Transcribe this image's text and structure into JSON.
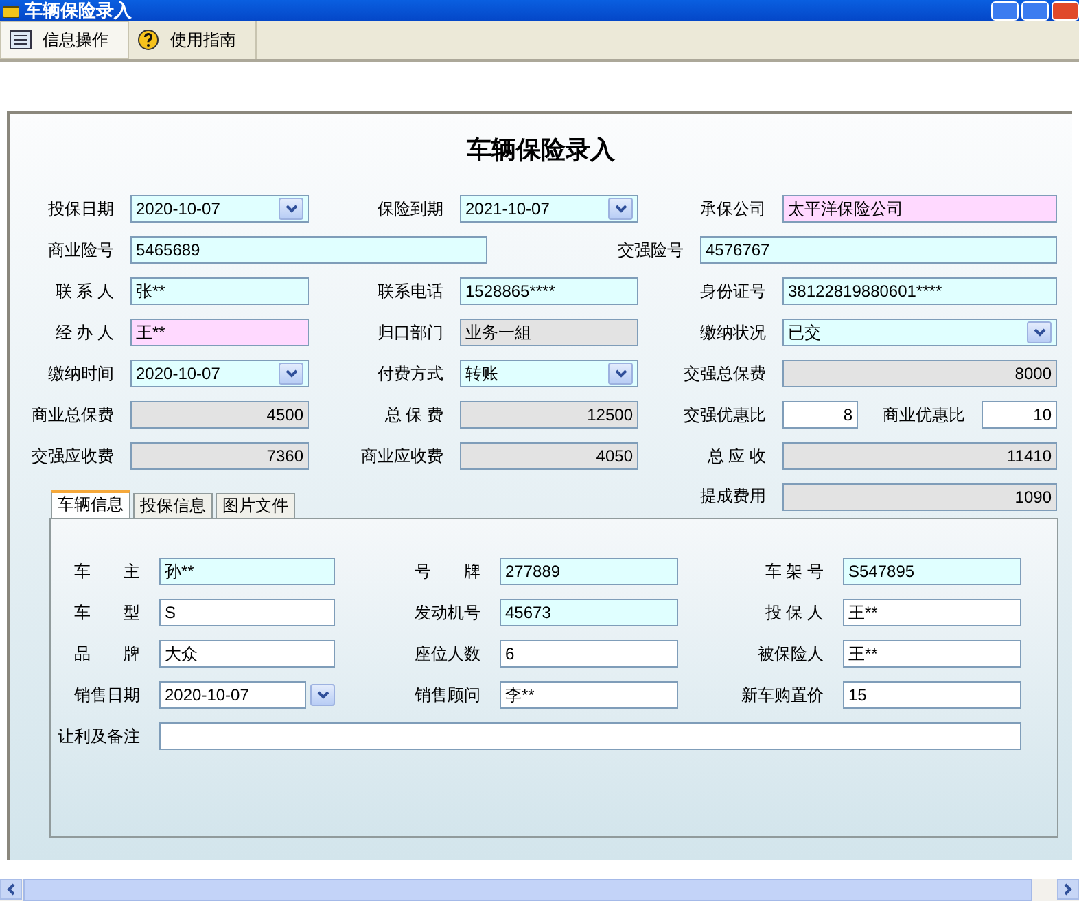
{
  "window": {
    "title": "车辆保险录入"
  },
  "toolbar": [
    {
      "label": "信息操作",
      "selected": true
    },
    {
      "label": "使用指南",
      "selected": false
    }
  ],
  "form": {
    "title": "车辆保险录入",
    "rows": [
      [
        {
          "label": "投保日期",
          "value": "2020-10-07",
          "kind": "date",
          "color": "#e0ffff"
        },
        {
          "label": "保险到期",
          "value": "2021-10-07",
          "kind": "date",
          "color": "#e0ffff"
        },
        {
          "label": "承保公司",
          "value": "太平洋保险公司",
          "kind": "text",
          "color": "#ffd9ff"
        }
      ],
      [
        {
          "label": "商业险号",
          "value": "5465689",
          "kind": "text",
          "color": "#e0ffff"
        },
        {
          "label": "交强险号",
          "value": "4576767",
          "kind": "text",
          "color": "#e0ffff"
        }
      ],
      [
        {
          "label": "联 系 人",
          "value": "张**",
          "kind": "text",
          "color": "#e0ffff"
        },
        {
          "label": "联系电话",
          "value": "1528865****",
          "kind": "text",
          "color": "#e0ffff"
        },
        {
          "label": "身份证号",
          "value": "38122819880601****",
          "kind": "text",
          "color": "#e0ffff"
        }
      ],
      [
        {
          "label": "经 办 人",
          "value": "王**",
          "kind": "text",
          "color": "#ffd9ff"
        },
        {
          "label": "归口部门",
          "value": "业务一組",
          "kind": "text",
          "color": "#e3e3e3"
        },
        {
          "label": "缴纳状况",
          "value": "已交",
          "kind": "select",
          "color": "#e0ffff"
        }
      ],
      [
        {
          "label": "缴纳时间",
          "value": "2020-10-07",
          "kind": "date",
          "color": "#e0ffff"
        },
        {
          "label": "付费方式",
          "value": "转账",
          "kind": "select",
          "color": "#e0ffff"
        },
        {
          "label": "交强总保费",
          "value": "8000",
          "kind": "number",
          "color": "#e3e3e3"
        }
      ],
      [
        {
          "label": "商业总保费",
          "value": "4500",
          "kind": "number",
          "color": "#e3e3e3"
        },
        {
          "label": "总 保 费",
          "value": "12500",
          "kind": "number",
          "color": "#e3e3e3"
        },
        {
          "label": "交强优惠比",
          "value": "8",
          "kind": "number",
          "color": "#ffffff"
        },
        {
          "label": "商业优惠比",
          "value": "10",
          "kind": "number",
          "color": "#ffffff"
        }
      ],
      [
        {
          "label": "交强应收费",
          "value": "7360",
          "kind": "number",
          "color": "#e3e3e3"
        },
        {
          "label": "商业应收费",
          "value": "4050",
          "kind": "number",
          "color": "#e3e3e3"
        },
        {
          "label": "总 应 收",
          "value": "11410",
          "kind": "number",
          "color": "#e3e3e3"
        }
      ]
    ],
    "commission": {
      "label": "提成费用",
      "value": "1090",
      "kind": "number",
      "color": "#e3e3e3"
    }
  },
  "tabs": [
    {
      "label": "车辆信息",
      "selected": true
    },
    {
      "label": "投保信息",
      "selected": false
    },
    {
      "label": "图片文件",
      "selected": false
    }
  ],
  "vehicle_rows": [
    [
      {
        "label": "车　　主",
        "value": "孙**",
        "kind": "text",
        "color": "#e0ffff"
      },
      {
        "label": "号　　牌",
        "value": "277889",
        "kind": "text",
        "color": "#e0ffff"
      },
      {
        "label": "车 架 号",
        "value": "S547895",
        "kind": "text",
        "color": "#e0ffff"
      }
    ],
    [
      {
        "label": "车　　型",
        "value": "S",
        "kind": "text",
        "color": "#ffffff"
      },
      {
        "label": "发动机号",
        "value": "45673",
        "kind": "text",
        "color": "#e0ffff"
      },
      {
        "label": "投 保 人",
        "value": "王**",
        "kind": "text",
        "color": "#ffffff"
      }
    ],
    [
      {
        "label": "品　　牌",
        "value": "大众",
        "kind": "text",
        "color": "#ffffff"
      },
      {
        "label": "座位人数",
        "value": "6",
        "kind": "text",
        "color": "#ffffff"
      },
      {
        "label": "被保险人",
        "value": "王**",
        "kind": "text",
        "color": "#ffffff"
      }
    ],
    [
      {
        "label": "销售日期",
        "value": "2020-10-07",
        "kind": "picker",
        "color": "#ffffff"
      },
      {
        "label": "销售顾问",
        "value": "李**",
        "kind": "text",
        "color": "#ffffff"
      },
      {
        "label": "新车购置价",
        "value": "15",
        "kind": "text",
        "color": "#ffffff"
      }
    ],
    [
      {
        "label": "让利及备注",
        "kind": "text",
        "color": "#ffffff"
      }
    ]
  ]
}
